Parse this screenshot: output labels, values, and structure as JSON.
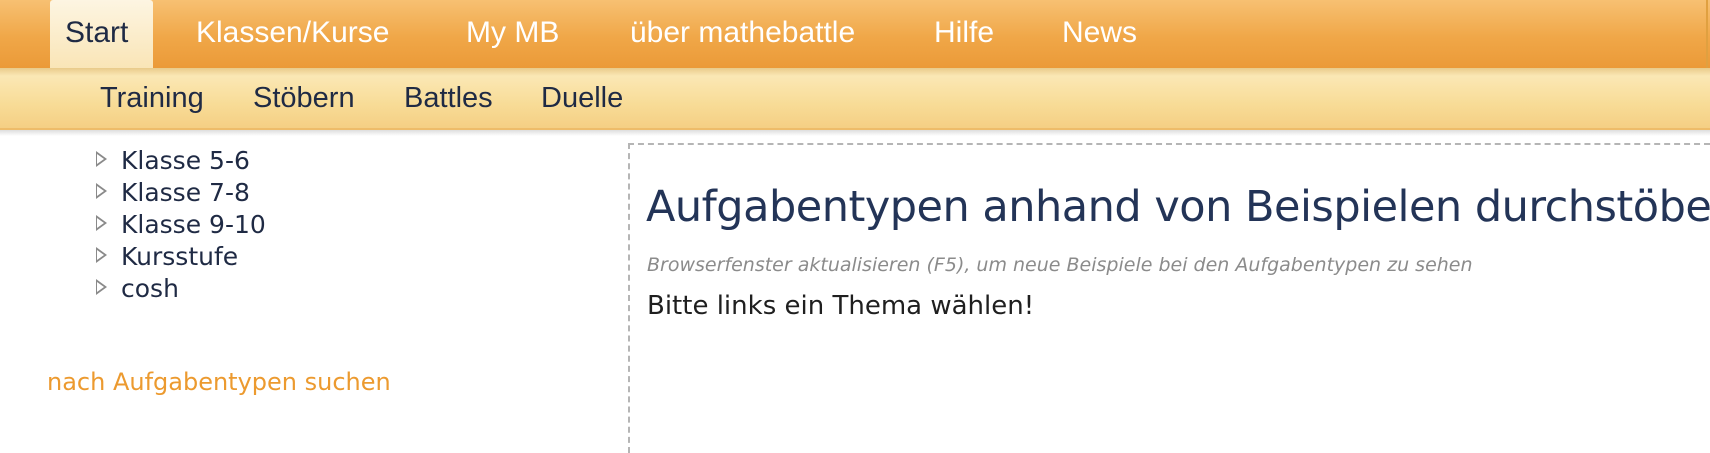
{
  "topnav": {
    "tabs": [
      {
        "label": "Start",
        "active": true
      },
      {
        "label": "Klassen/Kurse"
      },
      {
        "label": "My MB"
      },
      {
        "label": "über mathebattle"
      },
      {
        "label": "Hilfe"
      },
      {
        "label": "News"
      }
    ]
  },
  "subnav": {
    "items": [
      {
        "label": "Training"
      },
      {
        "label": "Stöbern"
      },
      {
        "label": "Battles"
      },
      {
        "label": "Duelle"
      }
    ]
  },
  "sidebar": {
    "tree": [
      {
        "label": "Klasse 5-6",
        "icon": "triangle-right-icon"
      },
      {
        "label": "Klasse 7-8",
        "icon": "triangle-right-icon"
      },
      {
        "label": "Klasse 9-10",
        "icon": "triangle-right-icon"
      },
      {
        "label": "Kursstufe",
        "icon": "triangle-right-icon"
      },
      {
        "label": "cosh",
        "icon": "triangle-right-icon"
      }
    ],
    "search_link": "nach Aufgabentypen suchen"
  },
  "main": {
    "title": "Aufgabentypen anhand von Beispielen durchstöbern",
    "hint": "Browserfenster aktualisieren (F5), um neue Beispiele bei den Aufgabentypen zu sehen",
    "prompt": "Bitte links ein Thema wählen!"
  },
  "colors": {
    "nav_orange": "#f0a748",
    "subnav_yellow": "#f8dc97",
    "text_dark": "#1f2a44",
    "title_navy": "#233457",
    "link_orange": "#ec9a2f",
    "hint_gray": "#8b8b8b"
  }
}
